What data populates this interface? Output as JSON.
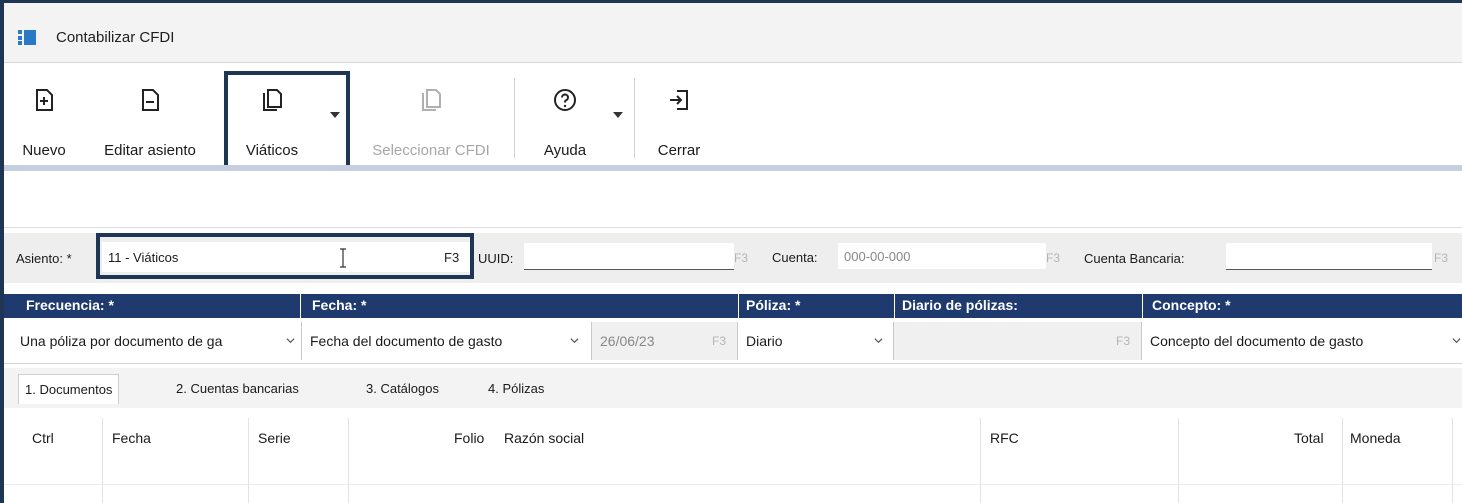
{
  "window": {
    "title": "Contabilizar CFDI",
    "icon": "app-icon"
  },
  "toolbar": {
    "nuevo": "Nuevo",
    "editar": "Editar asiento",
    "viaticos": "Viáticos",
    "seleccionar": "Seleccionar CFDI",
    "ayuda": "Ayuda",
    "cerrar": "Cerrar"
  },
  "asiento": {
    "label": "Asiento: *",
    "value": "11 - Viáticos",
    "f3": "F3",
    "uuid_label": "UUID:",
    "uuid_value": "",
    "cuenta_label": "Cuenta:",
    "cuenta_placeholder": "000-00-000",
    "cuenta_bancaria_label": "Cuenta Bancaria:",
    "cuenta_bancaria_value": ""
  },
  "headers": {
    "frecuencia": "Frecuencia: *",
    "fecha": "Fecha: *",
    "poliza": "Póliza: *",
    "diario": "Diario de pólizas:",
    "concepto": "Concepto: *"
  },
  "values": {
    "frecuencia": "Una póliza por documento de ga",
    "fecha": "Fecha del documento de gasto",
    "fecha_fija": "26/06/23",
    "poliza": "Diario",
    "diario": "",
    "concepto": "Concepto del documento de gasto"
  },
  "tabs": [
    "1. Documentos",
    "2. Cuentas bancarias",
    "3. Catálogos",
    "4. Pólizas"
  ],
  "grid": {
    "columns": [
      "Ctrl",
      "Fecha",
      "Serie",
      "Folio",
      "Razón social",
      "RFC",
      "Total",
      "Moneda"
    ]
  },
  "colors": {
    "accent": "#1e3a6e",
    "highlight": "#1e3554",
    "icon_blue": "#2b78c5"
  }
}
